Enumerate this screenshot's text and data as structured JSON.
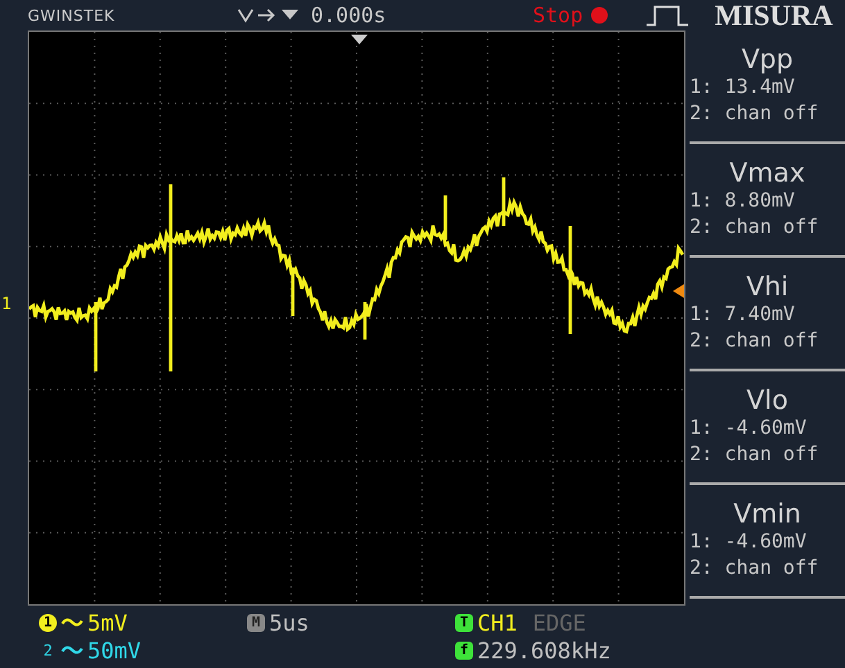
{
  "header": {
    "brand": "GWINSTEK",
    "trigger_position": "0.000s",
    "run_state": "Stop",
    "title": "MISURA"
  },
  "channel_marker": "1",
  "measurements": [
    {
      "name": "Vpp",
      "ch1": "1: 13.4mV",
      "ch2": "2: chan off"
    },
    {
      "name": "Vmax",
      "ch1": "1: 8.80mV",
      "ch2": "2: chan off"
    },
    {
      "name": "Vhi",
      "ch1": "1: 7.40mV",
      "ch2": "2: chan off"
    },
    {
      "name": "Vlo",
      "ch1": "1: -4.60mV",
      "ch2": "2: chan off"
    },
    {
      "name": "Vmin",
      "ch1": "1: -4.60mV",
      "ch2": "2: chan off"
    }
  ],
  "status": {
    "ch1_badge": "1",
    "ch1_scale": "5mV",
    "ch2_badge": "2",
    "ch2_scale": "50mV",
    "timebase_badge": "M",
    "timebase": "5us",
    "trigger_badge": "T",
    "trigger_source": "CH1",
    "trigger_type": "EDGE",
    "freq_badge": "f",
    "frequency": "229.608kHz"
  }
}
